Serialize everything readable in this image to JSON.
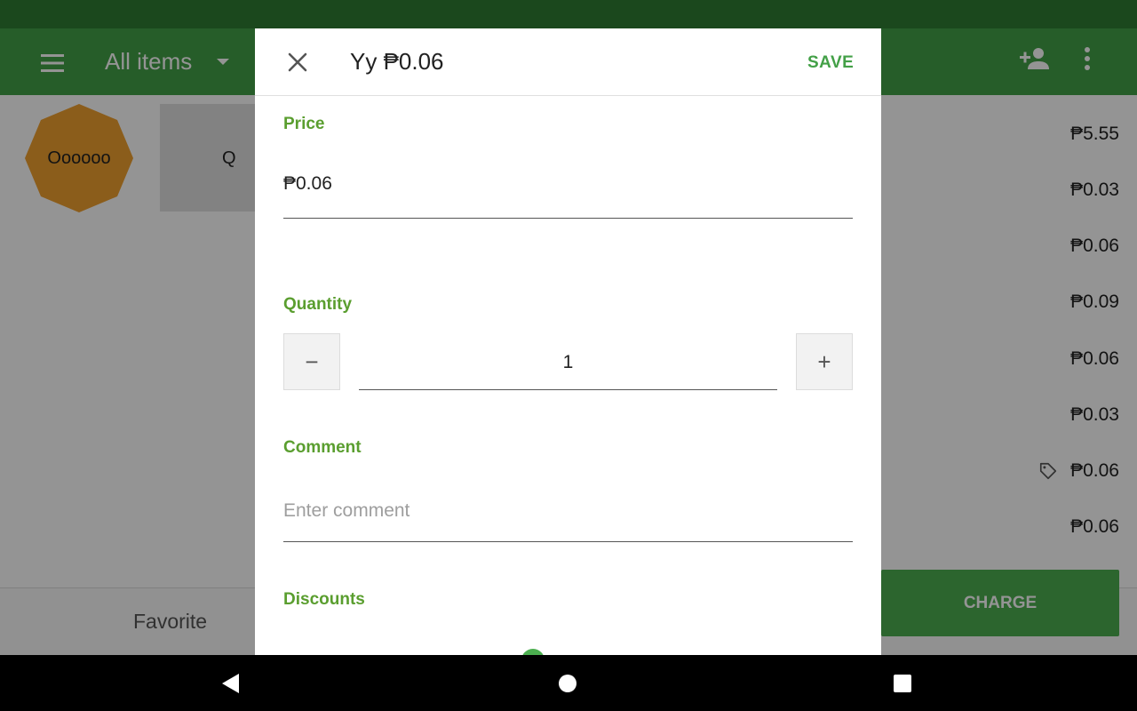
{
  "toolbar": {
    "title": "All items",
    "menu_icon": "hamburger-menu-icon",
    "dropdown_icon": "arrow-drop-down-icon",
    "add_customer_icon": "add-person-icon",
    "overflow_icon": "more-vert-icon"
  },
  "grid": {
    "items": [
      {
        "label": "Oooooo",
        "shape": "octagon",
        "color": "#f0a030"
      },
      {
        "label": "Q",
        "shape": "square",
        "color": "#e0e0e0"
      }
    ]
  },
  "ticket": {
    "rows": [
      {
        "amount": "₱5.55",
        "tag": false
      },
      {
        "amount": "₱0.03",
        "tag": false
      },
      {
        "amount": "₱0.06",
        "tag": false
      },
      {
        "amount": "₱0.09",
        "tag": false
      },
      {
        "amount": "₱0.06",
        "tag": false
      },
      {
        "amount": "₱0.03",
        "tag": false
      },
      {
        "amount": "₱0.06",
        "tag": true
      },
      {
        "amount": "₱0.06",
        "tag": false
      }
    ],
    "charge_label": "CHARGE"
  },
  "bottom_bar": {
    "favorite_tab": "Favorite"
  },
  "dialog": {
    "title": "Yy ₱0.06",
    "save_label": "SAVE",
    "price": {
      "label": "Price",
      "value": "₱0.06"
    },
    "quantity": {
      "label": "Quantity",
      "value": "1",
      "minus": "−",
      "plus": "+"
    },
    "comment": {
      "label": "Comment",
      "placeholder": "Enter comment"
    },
    "discounts": {
      "label": "Discounts"
    }
  },
  "colors": {
    "primary": "#43a047",
    "status_bar": "#2f7d32",
    "accent_label": "#5a9e2f"
  }
}
